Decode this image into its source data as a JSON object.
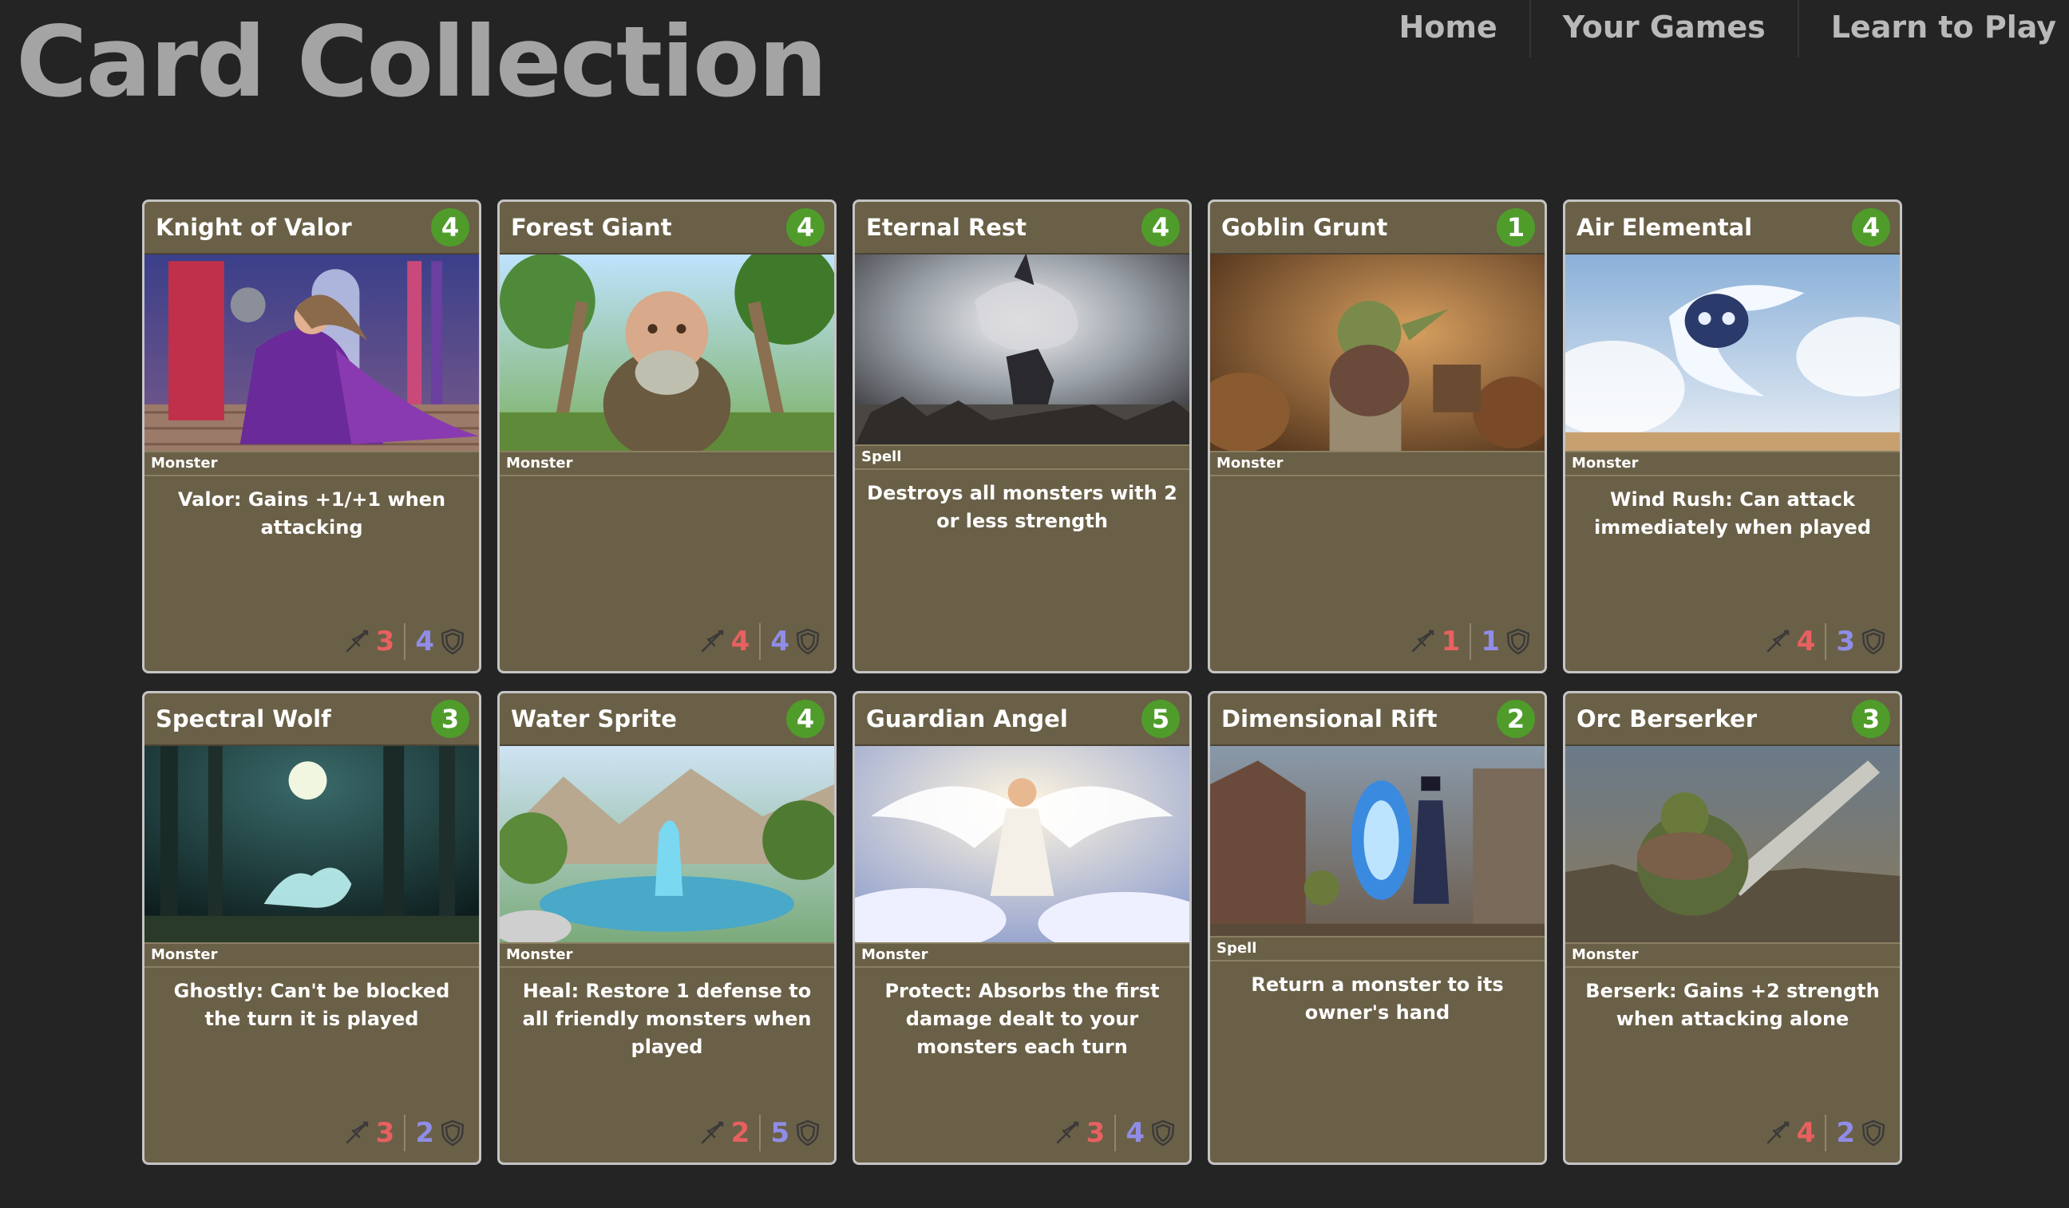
{
  "header": {
    "title": "Card Collection",
    "nav": [
      "Home",
      "Your Games",
      "Learn to Play"
    ]
  },
  "colors": {
    "background": "#242424",
    "card_bg": "#6a6047",
    "cost_badge": "#4f9c2b",
    "attack": "#e86060",
    "defense": "#8f8de8"
  },
  "cards": [
    {
      "name": "Knight of Valor",
      "cost": "4",
      "type": "Monster",
      "text": "Valor: Gains +1/+1 when attacking",
      "attack": "3",
      "defense": "4",
      "art": "knight"
    },
    {
      "name": "Forest Giant",
      "cost": "4",
      "type": "Monster",
      "text": "",
      "attack": "4",
      "defense": "4",
      "art": "giant"
    },
    {
      "name": "Eternal Rest",
      "cost": "4",
      "type": "Spell",
      "text": "Destroys all monsters with 2 or less strength",
      "art": "storm"
    },
    {
      "name": "Goblin Grunt",
      "cost": "1",
      "type": "Monster",
      "text": "",
      "attack": "1",
      "defense": "1",
      "art": "goblin"
    },
    {
      "name": "Air Elemental",
      "cost": "4",
      "type": "Monster",
      "text": "Wind Rush: Can attack immediately when played",
      "attack": "4",
      "defense": "3",
      "art": "air"
    },
    {
      "name": "Spectral Wolf",
      "cost": "3",
      "type": "Monster",
      "text": "Ghostly: Can't be blocked the turn it is played",
      "attack": "3",
      "defense": "2",
      "art": "wolf"
    },
    {
      "name": "Water Sprite",
      "cost": "4",
      "type": "Monster",
      "text": "Heal: Restore 1 defense to all friendly monsters when played",
      "attack": "2",
      "defense": "5",
      "art": "water"
    },
    {
      "name": "Guardian Angel",
      "cost": "5",
      "type": "Monster",
      "text": "Protect: Absorbs the first damage dealt to your monsters each turn",
      "attack": "3",
      "defense": "4",
      "art": "angel"
    },
    {
      "name": "Dimensional Rift",
      "cost": "2",
      "type": "Spell",
      "text": "Return a monster to its owner's hand",
      "art": "rift"
    },
    {
      "name": "Orc Berserker",
      "cost": "3",
      "type": "Monster",
      "text": "Berserk: Gains +2 strength when attacking alone",
      "attack": "4",
      "defense": "2",
      "art": "orc"
    }
  ]
}
